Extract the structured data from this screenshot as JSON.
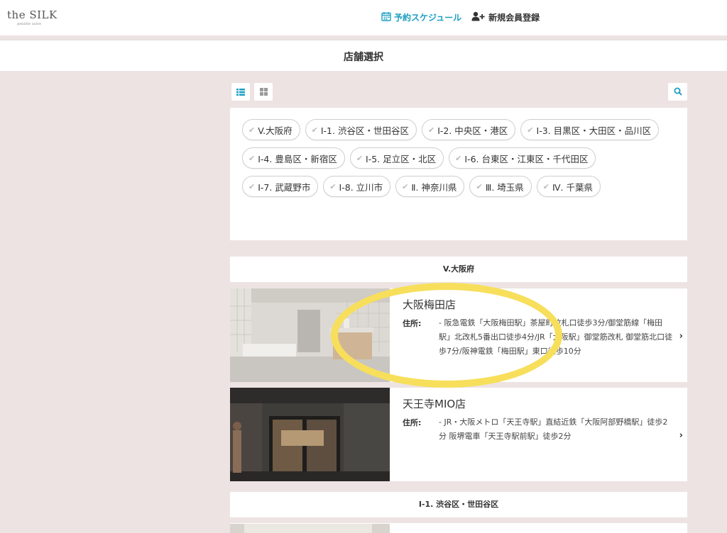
{
  "header": {
    "logo": "the SILK",
    "logo_tagline": "petalite salon",
    "nav": [
      {
        "label": "予約スケジュール",
        "icon": "calendar-icon"
      },
      {
        "label": "新規会員登録",
        "icon": "user-add-icon"
      }
    ]
  },
  "page": {
    "title": "店舗選択"
  },
  "toolbar": {
    "view_list_icon": "list-view-icon",
    "view_grid_icon": "grid-view-icon",
    "search_icon": "search-icon"
  },
  "filters": [
    "V.大阪府",
    "Ⅰ-1. 渋谷区・世田谷区",
    "Ⅰ-2. 中央区・港区",
    "Ⅰ-3. 目黒区・大田区・品川区",
    "Ⅰ-4. 豊島区・新宿区",
    "Ⅰ-5. 足立区・北区",
    "Ⅰ-6. 台東区・江東区・千代田区",
    "Ⅰ-7. 武蔵野市",
    "Ⅰ-8. 立川市",
    "Ⅱ. 神奈川県",
    "Ⅲ. 埼玉県",
    "Ⅳ. 千葉県"
  ],
  "sections": [
    {
      "title": "V.大阪府",
      "stores": [
        {
          "name": "大阪梅田店",
          "address_label": "住所:",
          "address": "- 阪急電鉄「大阪梅田駅」茶屋町改札口徒歩3分/御堂筋線「梅田駅」北改札5番出口徒歩4分/JR「大阪駅」御堂筋改札 御堂筋北口徒歩7分/阪神電鉄「梅田駅」東口徒歩10分"
        },
        {
          "name": "天王寺MIO店",
          "address_label": "住所:",
          "address": "- JR・大阪メトロ「天王寺駅」直結近鉄「大阪阿部野橋駅」徒歩2分 阪堺電車「天王寺駅前駅」徒歩2分"
        }
      ]
    },
    {
      "title": "Ⅰ-1. 渋谷区・世田谷区"
    }
  ],
  "colors": {
    "accent": "#1d9fc1",
    "background": "#ede3e3",
    "highlight": "#f7df5b"
  }
}
